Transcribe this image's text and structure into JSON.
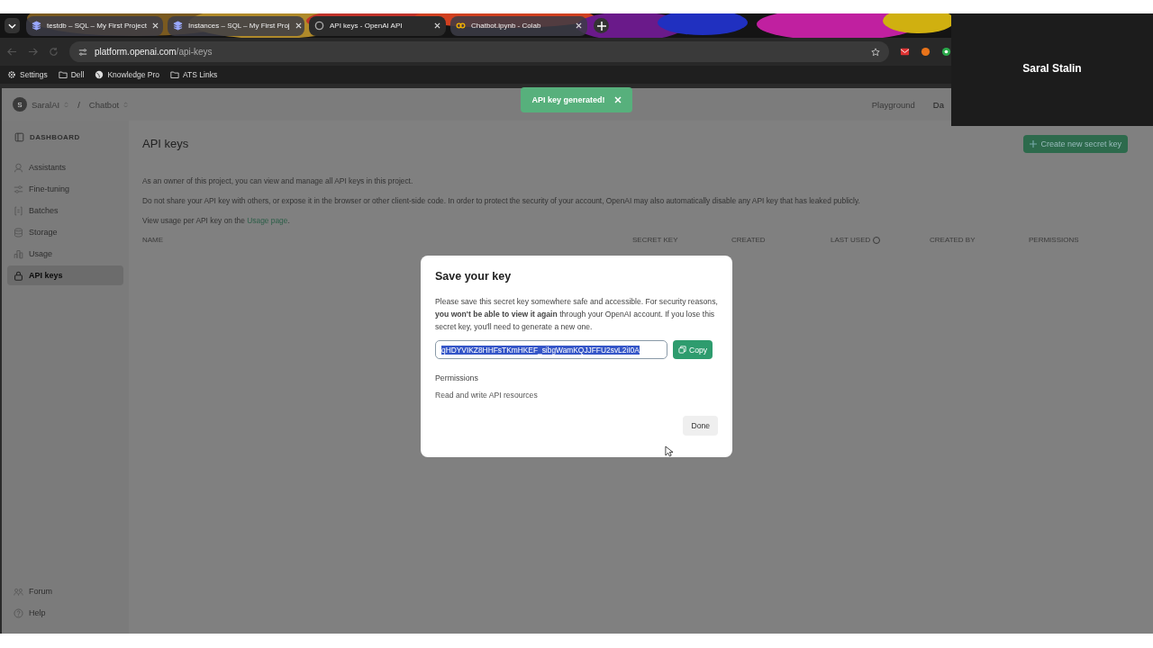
{
  "browser": {
    "tabs": [
      {
        "title": "testdb – SQL – My First Project",
        "selected": false
      },
      {
        "title": "Instances – SQL – My First Proj",
        "selected": false
      },
      {
        "title": "API keys - OpenAI API",
        "selected": true
      },
      {
        "title": "Chatbot.ipynb - Colab",
        "selected": false
      }
    ],
    "url_host": "platform.openai.com",
    "url_path": "/api-keys",
    "bookmarks": [
      "Settings",
      "Dell",
      "Knowledge Pro",
      "ATS Links"
    ]
  },
  "header": {
    "org_initial": "S",
    "org": "SaralAI",
    "separator": "/",
    "project": "Chatbot",
    "links": [
      "Playground",
      "Da"
    ]
  },
  "toast": {
    "text": "API key generated!"
  },
  "video_overlay": {
    "name": "Saral Stalin"
  },
  "sidebar": {
    "heading": "DASHBOARD",
    "items": [
      {
        "label": "Assistants",
        "selected": false
      },
      {
        "label": "Fine-tuning",
        "selected": false
      },
      {
        "label": "Batches",
        "selected": false
      },
      {
        "label": "Storage",
        "selected": false
      },
      {
        "label": "Usage",
        "selected": false
      },
      {
        "label": "API keys",
        "selected": true
      }
    ],
    "footer": [
      "Forum",
      "Help"
    ]
  },
  "main": {
    "title": "API keys",
    "create_button": "Create new secret key",
    "paragraphs": [
      "As an owner of this project, you can view and manage all API keys in this project.",
      "Do not share your API key with others, or expose it in the browser or other client-side code. In order to protect the security of your account, OpenAI may also automatically disable any API key that has leaked publicly."
    ],
    "usage_text": "View usage per API key on the",
    "usage_link": "Usage page",
    "usage_suffix": ".",
    "columns": [
      "NAME",
      "SECRET KEY",
      "CREATED",
      "LAST USED",
      "CREATED BY",
      "PERMISSIONS"
    ]
  },
  "dialog": {
    "title": "Save your key",
    "body": "Please save this secret key somewhere safe and accessible. For security reasons, **you won't be able to view it again** through your OpenAI account. If you lose this secret key, you'll need to generate a new one.",
    "key_value": "qHDYVIKZ8HHFsTKmHKEF_sibgWamKQJJFFU2svL2iI0A",
    "key_selected": true,
    "copy_button": "Copy",
    "permissions_label": "Permissions",
    "permissions_value": "Read and write API resources",
    "done_button": "Done"
  }
}
